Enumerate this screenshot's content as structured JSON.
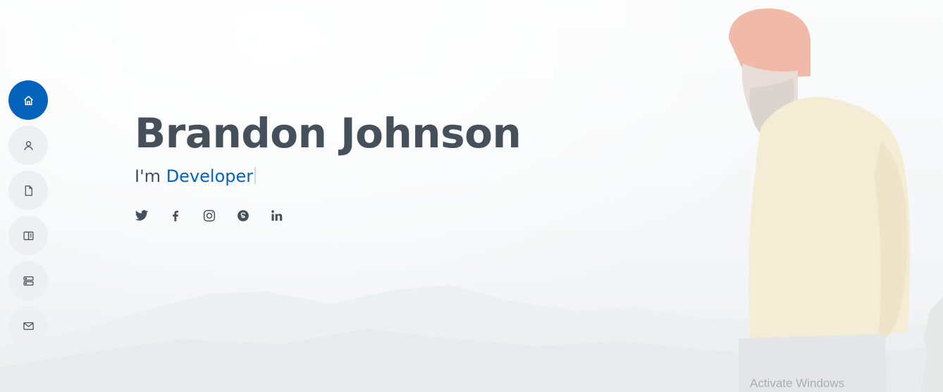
{
  "progress": {
    "scrolled_fraction": 0.89
  },
  "hero": {
    "name": "Brandon Johnson",
    "subtitle_prefix": "I'm",
    "role": "Developer"
  },
  "nav": {
    "items": [
      {
        "name": "home",
        "icon": "house-icon",
        "active": true
      },
      {
        "name": "about",
        "icon": "person-icon",
        "active": false
      },
      {
        "name": "resume",
        "icon": "file-icon",
        "active": false
      },
      {
        "name": "portfolio",
        "icon": "book-half-icon",
        "active": false
      },
      {
        "name": "services",
        "icon": "server-icon",
        "active": false
      },
      {
        "name": "contact",
        "icon": "envelope-icon",
        "active": false
      }
    ]
  },
  "social": [
    {
      "name": "twitter",
      "icon": "twitter-icon"
    },
    {
      "name": "facebook",
      "icon": "facebook-icon"
    },
    {
      "name": "instagram",
      "icon": "instagram-icon"
    },
    {
      "name": "skype",
      "icon": "skype-icon"
    },
    {
      "name": "linkedin",
      "icon": "linkedin-icon"
    }
  ],
  "watermark": {
    "text": "Activate Windows"
  },
  "colors": {
    "accent": "#0563bb",
    "text": "#45505b",
    "nav_bg": "#eeeff1",
    "progress": "#0d4c6b"
  }
}
